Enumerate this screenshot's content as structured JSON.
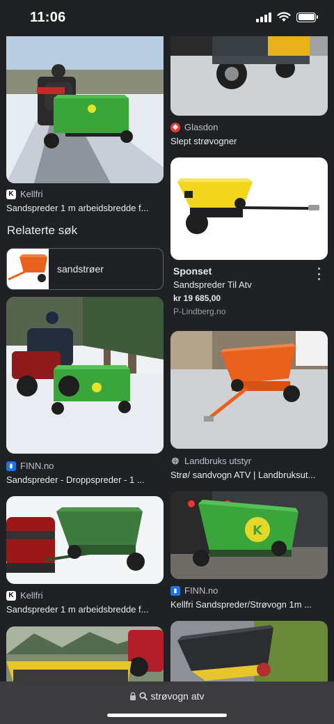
{
  "status": {
    "time": "11:06"
  },
  "related": {
    "heading": "Relaterte søk",
    "chip_label": "sandstrøer"
  },
  "left_column": [
    {
      "source": "Kellfri",
      "source_icon": "kellfri-logo-icon",
      "title": "Sandspreder 1 m arbeidsbredde f..."
    },
    {
      "source": "FINN.no",
      "source_icon": "finn-logo-icon",
      "title": "Sandspreder - Droppspreder - 1 ..."
    },
    {
      "source": "Kellfri",
      "source_icon": "kellfri-logo-icon",
      "title": "Sandspreder 1 m arbeidsbredde f..."
    }
  ],
  "right_column": [
    {
      "source": "Glasdon",
      "source_icon": "glasdon-logo-icon",
      "title": "Slept strøvogner"
    },
    {
      "source": "Landbruks utstyr",
      "source_icon": "globe-icon",
      "title": "Strø/ sandvogn ATV | Landbruksut..."
    },
    {
      "source": "FINN.no",
      "source_icon": "finn-logo-icon",
      "title": "Kellfri Sandspreder/Strøvogn 1m ..."
    }
  ],
  "sponsored": {
    "label": "Sponset",
    "title": "Sandspreder Til Atv",
    "price": "kr 19 685,00",
    "domain": "P-Lindberg.no"
  },
  "url_bar": {
    "text": "strøvogn atv"
  },
  "colors": {
    "background": "#202124",
    "spreader_green": "#3aa53a",
    "spreader_orange": "#e8621e",
    "spreader_yellow": "#f2d61e"
  }
}
